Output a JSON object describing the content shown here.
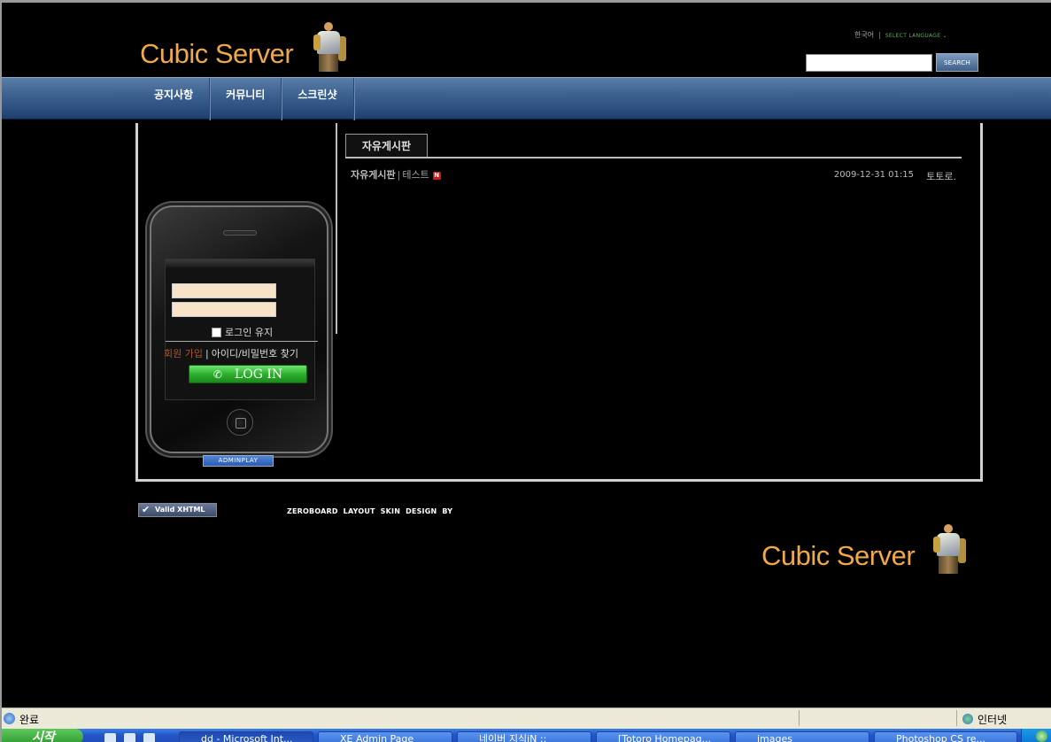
{
  "header": {
    "logo_text": "Cubic Server",
    "language_current": "한국어",
    "language_separator": "|",
    "language_select": "SELECT LANGUAGE ⌄",
    "search_button": "SEARCH",
    "search_value": ""
  },
  "nav": {
    "items": [
      {
        "label": "공지사항"
      },
      {
        "label": "커뮤니티"
      },
      {
        "label": "스크린샷"
      }
    ]
  },
  "content": {
    "tab_label": "자유게시판",
    "posts": [
      {
        "board": "자유게시판",
        "separator": "|",
        "title": "테스트",
        "new_badge": "N",
        "date": "2009-12-31 01:15",
        "author": "토토로."
      }
    ]
  },
  "login": {
    "id_value": "",
    "pw_value": "",
    "keep_label": "로그인 유지",
    "join_label": "회원 가입",
    "links_separator": "|",
    "find_label": "아이디/비밀번호 찾기",
    "login_button": "LOG IN",
    "phone_glyph": "✆",
    "adminplay": "ADMINPLAY"
  },
  "footer": {
    "valid_xhtml": "Valid XHTML",
    "valid_check": "✔",
    "credit": "ZEROBOARD   LAYOUT SKIN DESIGN BY",
    "logo_text": "Cubic Server"
  },
  "browser": {
    "status_text": "완료",
    "zone_text": "인터넷"
  },
  "taskbar": {
    "start_label": "시작",
    "tasks": [
      {
        "label": "dd - Microsoft Int..."
      },
      {
        "label": "XE Admin Page"
      },
      {
        "label": "네이버 지식iN ::"
      },
      {
        "label": "[Totoro Homepag..."
      },
      {
        "label": "images"
      },
      {
        "label": "Photoshop CS re..."
      }
    ]
  },
  "colors": {
    "logo": "#f0a848",
    "nav_bar": "#3d6290",
    "login_button": "#2eb02e",
    "new_badge": "#c81818"
  }
}
